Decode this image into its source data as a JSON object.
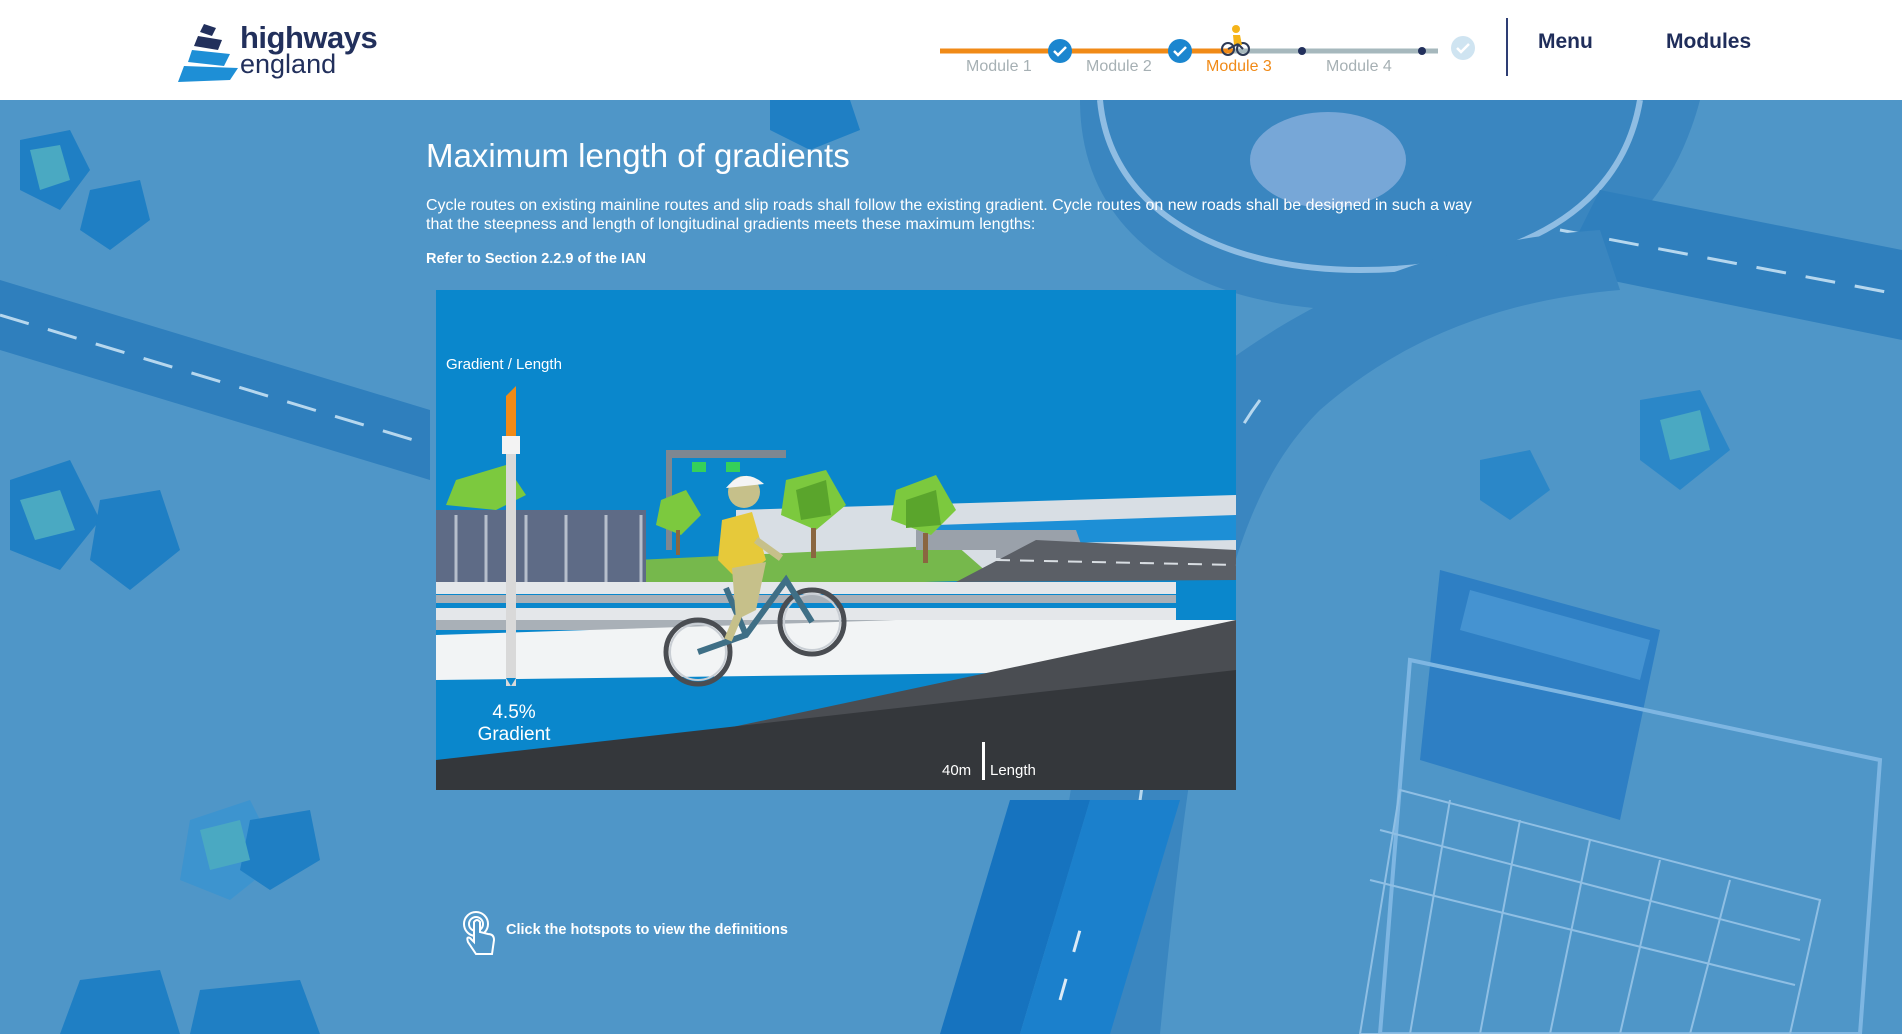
{
  "brand": {
    "line1": "highways",
    "line2": "england",
    "navy": "#22305c",
    "blue": "#1e8fd6"
  },
  "progress": {
    "modules": [
      {
        "label": "Module 1",
        "status": "complete"
      },
      {
        "label": "Module 2",
        "status": "complete"
      },
      {
        "label": "Module 3",
        "status": "current"
      },
      {
        "label": "Module 4",
        "status": "upcoming"
      }
    ],
    "icons": [
      "check-icon",
      "check-icon",
      "cyclist-icon",
      "check-icon"
    ],
    "colors": {
      "done": "#f08a17",
      "pending": "#a6b8bd",
      "check": "#1b86cf"
    }
  },
  "nav": {
    "menu": "Menu",
    "modules": "Modules"
  },
  "page": {
    "title": "Maximum length of gradients",
    "intro": "Cycle routes on existing mainline routes and slip roads shall follow the existing gradient. Cycle routes on new roads shall be designed in such a way that the steepness and length of longitudinal gradients meets these maximum lengths:",
    "reference": "Refer to Section 2.2.9 of the IAN"
  },
  "illustration": {
    "slider_label": "Gradient / Length",
    "gradient_value": "4.5%",
    "gradient_label": "Gradient",
    "length_value": "40m",
    "length_label": "Length",
    "slider_level": 0.18,
    "colors": {
      "sky": "#0a87cc",
      "road": "#4a4d52",
      "slider_fill": "#f08a17"
    }
  },
  "hint": {
    "text": "Click the hotspots to view the definitions",
    "icon": "touch-hand-icon"
  }
}
